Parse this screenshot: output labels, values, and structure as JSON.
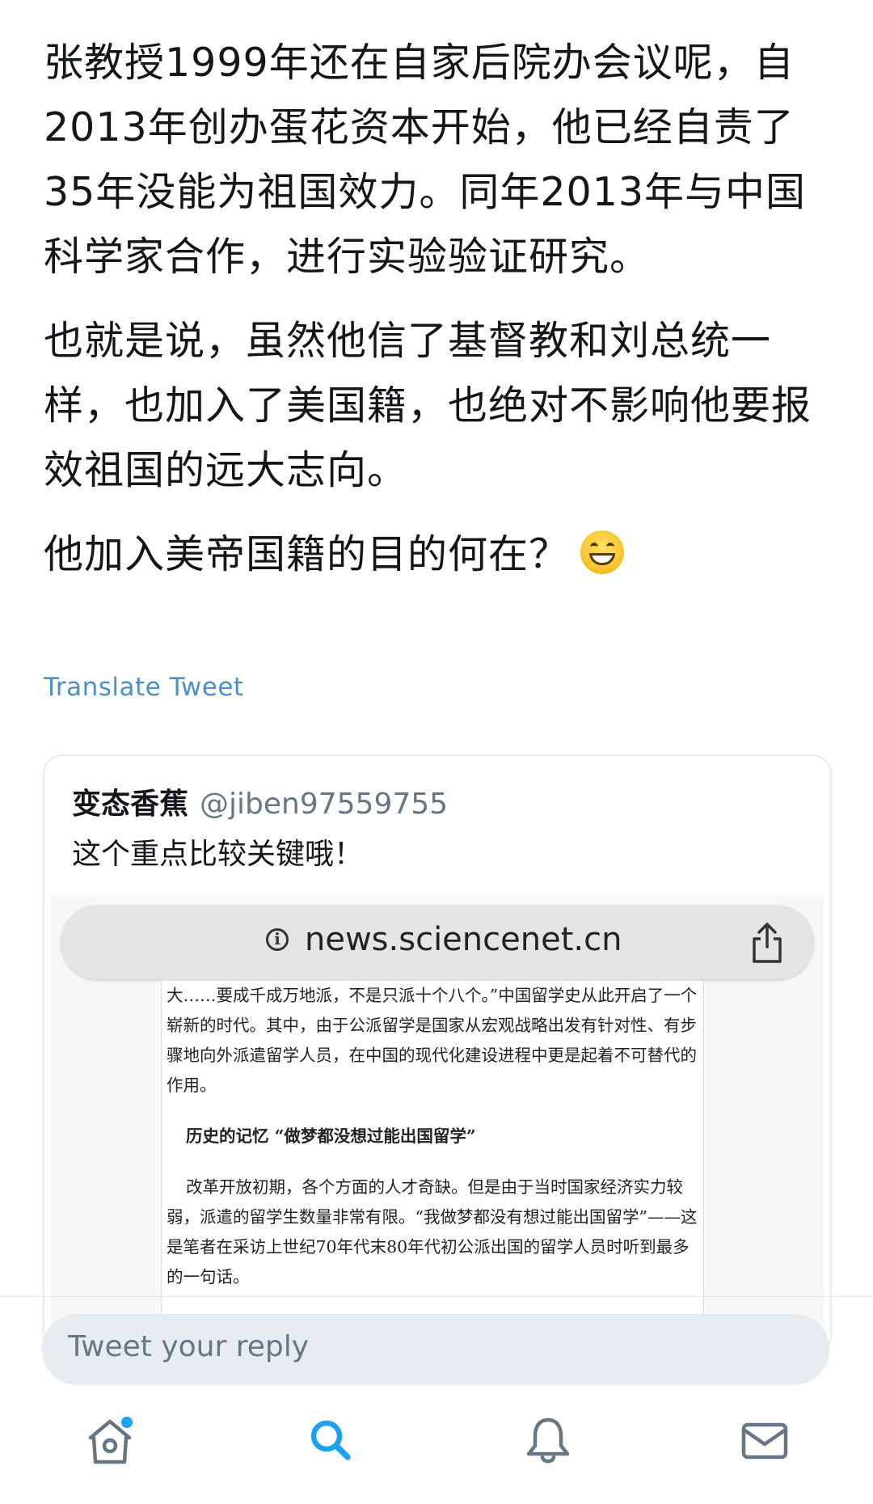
{
  "tweet": {
    "paragraphs": [
      "张教授1999年还在自家后院办会议呢，自2013年创办蛋花资本开始，他已经自责了35年没能为祖国效力。同年2013年与中国科学家合作，进行实验验证研究。",
      "也就是说，虽然他信了基督教和刘总统一样，也加入了美国籍，也绝对不影响他要报效祖国的远大志向。",
      "他加入美帝国籍的目的何在？"
    ],
    "emoji": "grinning-face",
    "translate_label": "Translate Tweet"
  },
  "quoted": {
    "name": "变态香蕉",
    "handle": "@jiben97559755",
    "text": "这个重点比较关键哦！",
    "screenshot": {
      "url": "news.sciencenet.cn",
      "article": {
        "p1": "大……要成千成万地派，不是只派十个八个。”中国留学史从此开启了一个崭新的时代。其中，由于公派留学是国家从宏观战略出发有针对性、有步骤地向外派遣留学人员，在中国的现代化建设进程中更是起着不可替代的作用。",
        "heading": "历史的记忆 “做梦都没想过能出国留学”",
        "p2": "改革开放初期，各个方面的人才奇缺。但是由于当时国家经济实力较弱，派遣的留学生数量非常有限。“我做梦都没有想过能出国留学”——这是笔者在采访上世纪70年代末80年代初公派出国的留学人员时听到最多的一句话。"
      }
    }
  },
  "reply": {
    "placeholder": "Tweet your reply"
  },
  "tabbar": {
    "items": [
      "home-icon",
      "search-icon",
      "notifications-icon",
      "messages-icon"
    ],
    "accent": "#1da1f2"
  }
}
